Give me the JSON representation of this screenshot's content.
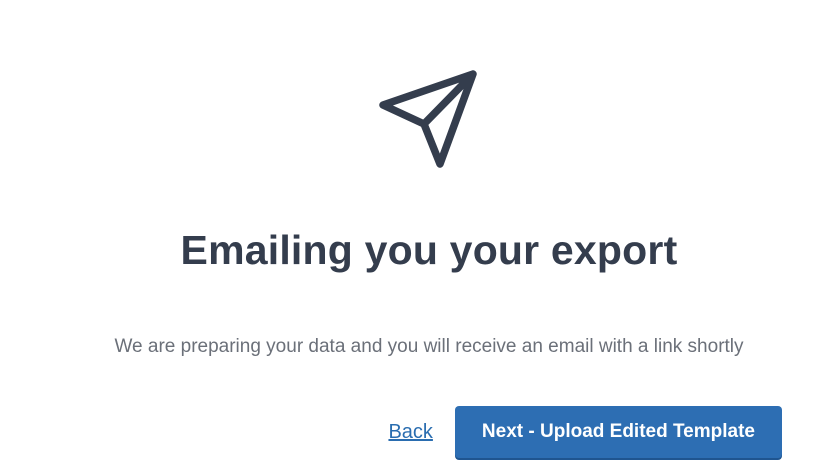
{
  "dialog": {
    "icon": "send-paper-plane-icon",
    "title": "Emailing you your export",
    "message": "We are preparing your data and you will receive an email with a link shortly"
  },
  "actions": {
    "back_label": "Back",
    "next_label": "Next - Upload Edited Template"
  },
  "colors": {
    "title": "#343d4d",
    "message": "#6b7079",
    "link": "#2a6db0",
    "primary_button": "#2d6eb3",
    "icon_stroke": "#343d4d"
  }
}
